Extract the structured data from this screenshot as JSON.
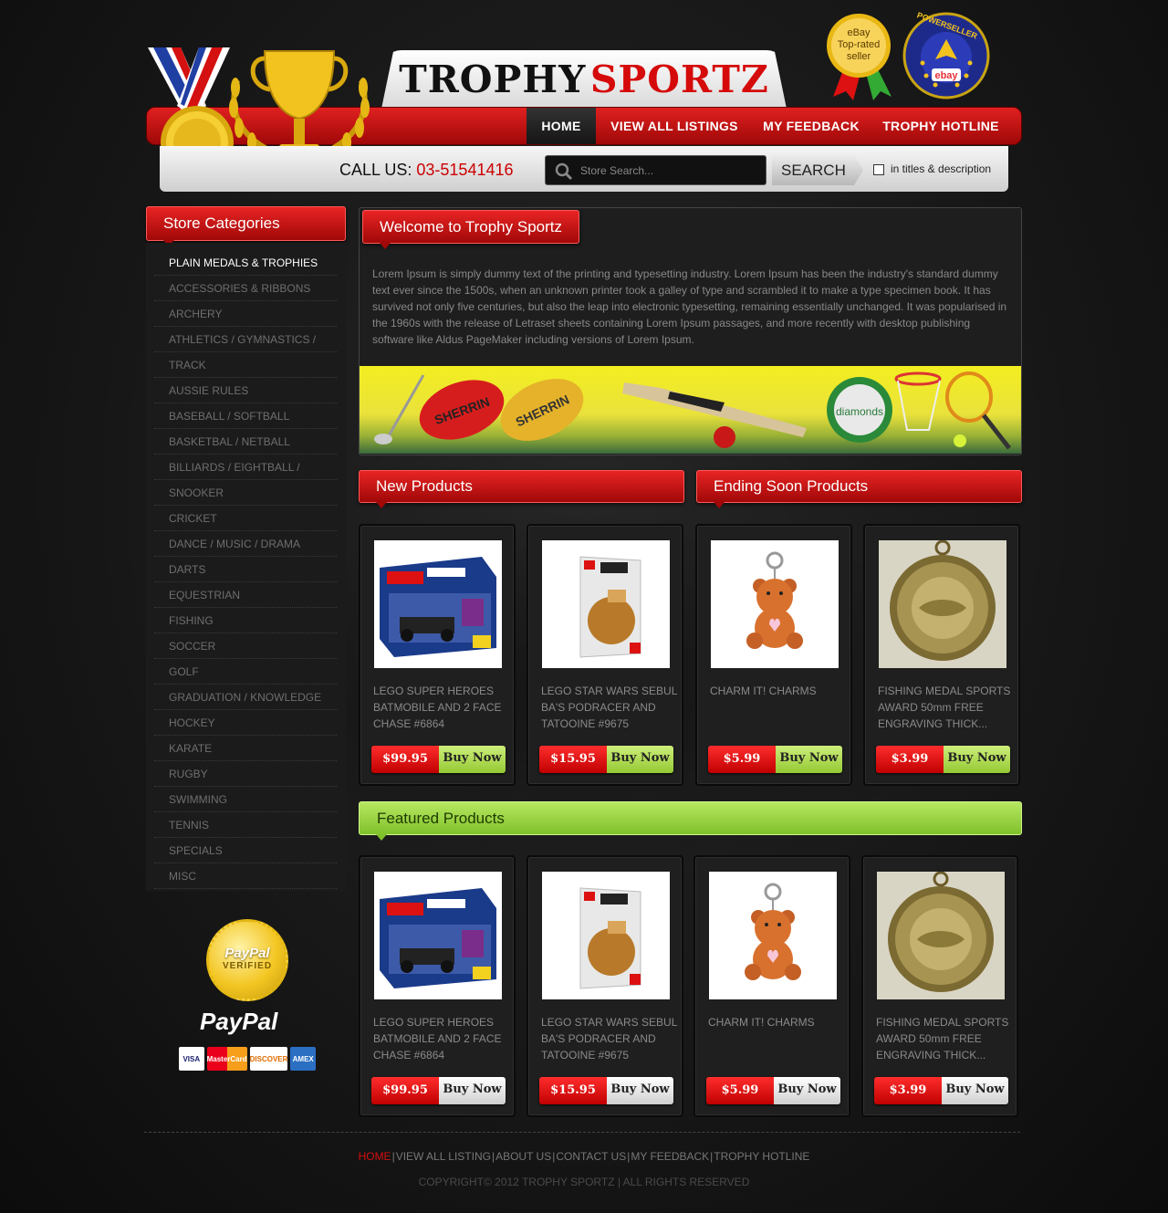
{
  "header": {
    "logo_part1": "TROPHY",
    "logo_part2": "SPORTZ",
    "badge_toprated": [
      "eBay",
      "Top-rated",
      "seller"
    ],
    "badge_powerseller": "POWERSELLER",
    "nav": [
      {
        "label": "HOME",
        "active": true
      },
      {
        "label": "VIEW ALL LISTINGS",
        "active": false
      },
      {
        "label": "MY FEEDBACK",
        "active": false
      },
      {
        "label": "TROPHY HOTLINE",
        "active": false
      }
    ],
    "call_label": "CALL US:",
    "call_number": "03-51541416",
    "search_placeholder": "Store Search...",
    "search_button": "SEARCH",
    "search_option": "in titles & description"
  },
  "sidebar": {
    "title": "Store Categories",
    "items": [
      "PLAIN MEDALS & TROPHIES",
      "ACCESSORIES & RIBBONS",
      "ARCHERY",
      "ATHLETICS / GYMNASTICS /",
      "TRACK",
      "AUSSIE RULES",
      "BASEBALL / SOFTBALL",
      "BASKETBAL  / NETBALL",
      "BILLIARDS / EIGHTBALL /",
      "SNOOKER",
      "CRICKET",
      "DANCE / MUSIC / DRAMA",
      "DARTS",
      "EQUESTRIAN",
      "FISHING",
      "SOCCER",
      "GOLF",
      "GRADUATION / KNOWLEDGE",
      "HOCKEY",
      "KARATE",
      "RUGBY",
      "SWIMMING",
      "TENNIS",
      "SPECIALS",
      "MISC"
    ],
    "paypal_badge": [
      "PayPal",
      "VERIFIED"
    ],
    "paypal_logo": "PayPal",
    "cards": [
      "VISA",
      "MasterCard",
      "DISCOVER",
      "AMEX"
    ]
  },
  "welcome": {
    "title": "Welcome to Trophy Sportz",
    "text": "Lorem Ipsum is simply dummy text of the printing and typesetting industry. Lorem Ipsum has been the industry's standard dummy text ever since the 1500s, when an unknown printer took a galley of type and scrambled it to make a type specimen book. It has survived not only five centuries, but also the leap into electronic typesetting, remaining essentially unchanged. It was popularised in the 1960s with the release of Letraset sheets containing Lorem Ipsum passages, and more recently with desktop publishing software like Aldus PageMaker including versions of Lorem Ipsum.",
    "banner_words": [
      "SHERRIN",
      "SHERRIN",
      "diamonds"
    ]
  },
  "sections": {
    "new": "New Products",
    "ending": "Ending Soon Products",
    "featured": "Featured Products"
  },
  "products_top": [
    {
      "name": "LEGO SUPER HEROES BATMOBILE AND 2 FACE CHASE #6864",
      "price": "$99.95",
      "buy": "Buy Now",
      "kind": "lego-batman"
    },
    {
      "name": "LEGO STAR WARS SEBUL BA'S PODRACER AND TATOOINE #9675",
      "price": "$15.95",
      "buy": "Buy Now",
      "kind": "lego-starwars"
    },
    {
      "name": "CHARM IT! CHARMS",
      "price": "$5.99",
      "buy": "Buy Now",
      "kind": "charm"
    },
    {
      "name": "FISHING MEDAL SPORTS AWARD 50mm FREE ENGRAVING THICK...",
      "price": "$3.99",
      "buy": "Buy Now",
      "kind": "medal"
    }
  ],
  "products_featured": [
    {
      "name": "LEGO SUPER HEROES BATMOBILE AND 2 FACE CHASE #6864",
      "price": "$99.95",
      "buy": "Buy Now",
      "kind": "lego-batman"
    },
    {
      "name": "LEGO STAR WARS SEBUL BA'S PODRACER AND TATOOINE #9675",
      "price": "$15.95",
      "buy": "Buy Now",
      "kind": "lego-starwars"
    },
    {
      "name": "CHARM IT! CHARMS",
      "price": "$5.99",
      "buy": "Buy Now",
      "kind": "charm"
    },
    {
      "name": "FISHING MEDAL SPORTS AWARD 50mm FREE ENGRAVING THICK...",
      "price": "$3.99",
      "buy": "Buy Now",
      "kind": "medal"
    }
  ],
  "footer": {
    "links": [
      {
        "label": "HOME",
        "active": true
      },
      {
        "label": "VIEW ALL LISTING",
        "active": false
      },
      {
        "label": "ABOUT US",
        "active": false
      },
      {
        "label": "CONTACT US",
        "active": false
      },
      {
        "label": "MY FEEDBACK",
        "active": false
      },
      {
        "label": "TROPHY HOTLINE",
        "active": false
      }
    ],
    "copyright": "COPYRIGHT© 2012 TROPHY SPORTZ | ALL RIGHTS RESERVED"
  },
  "colors": {
    "accent_red": "#d50a0a",
    "accent_green": "#8fcb35",
    "background": "#1a1a1a"
  }
}
